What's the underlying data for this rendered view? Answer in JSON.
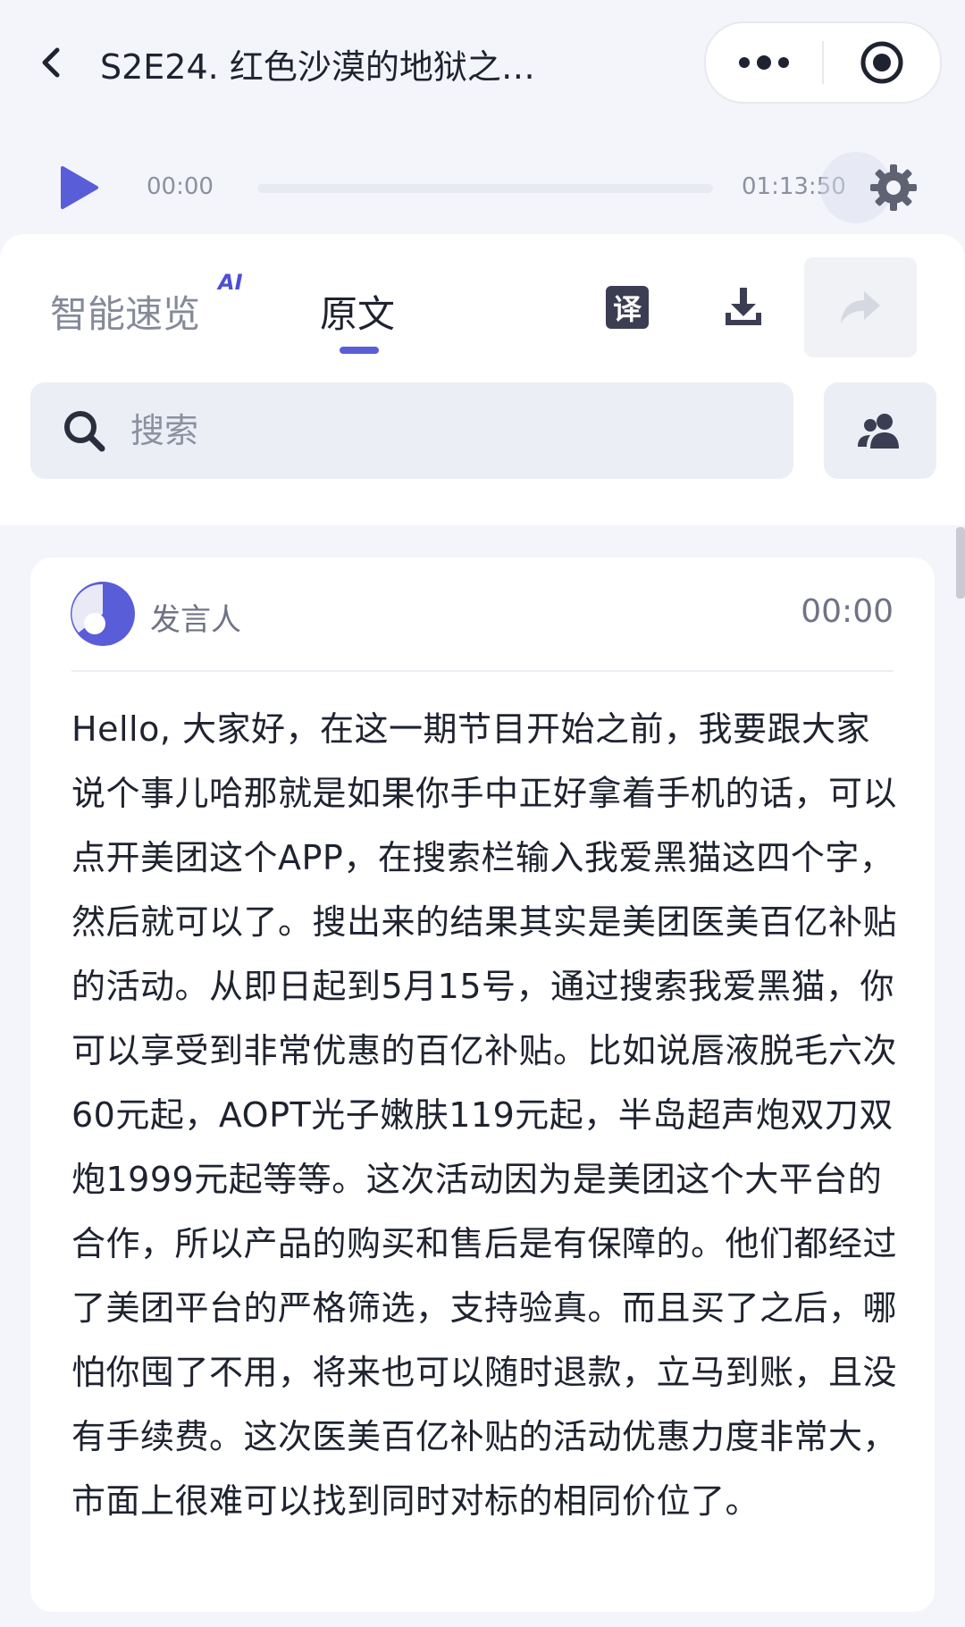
{
  "header": {
    "title": "S2E24. 红色沙漠的地狱之门…"
  },
  "player": {
    "current_time": "00:00",
    "total_time": "01:13:50",
    "progress": 0
  },
  "tabs": [
    {
      "label": "智能速览",
      "badge": "AI"
    },
    {
      "label": "原文"
    }
  ],
  "toolbar": {
    "translate_label": "译"
  },
  "search": {
    "placeholder": "搜索"
  },
  "segment": {
    "speaker": "发言人",
    "timestamp": "00:00",
    "text": "Hello, 大家好，在这一期节目开始之前，我要跟大家说个事儿哈那就是如果你手中正好拿着手机的话，可以点开美团这个APP，在搜索栏输入我爱黑猫这四个字，然后就可以了。搜出来的结果其实是美团医美百亿补贴的活动。从即日起到5月15号，通过搜索我爱黑猫，你可以享受到非常优惠的百亿补贴。比如说唇液脱毛六次60元起，AOPT光子嫩肤119元起，半岛超声炮双刀双炮1999元起等等。这次活动因为是美团这个大平台的合作，所以产品的购买和售后是有保障的。他们都经过了美团平台的严格筛选，支持验真。而且买了之后，哪怕你囤了不用，将来也可以随时退款，立马到账，且没有手续费。这次医美百亿补贴的活动优惠力度非常大，市面上很难可以找到同时对标的相同价位了。"
  },
  "colors": {
    "accent": "#5a5dd8",
    "text": "#1f2330",
    "muted": "#8c90a0"
  }
}
